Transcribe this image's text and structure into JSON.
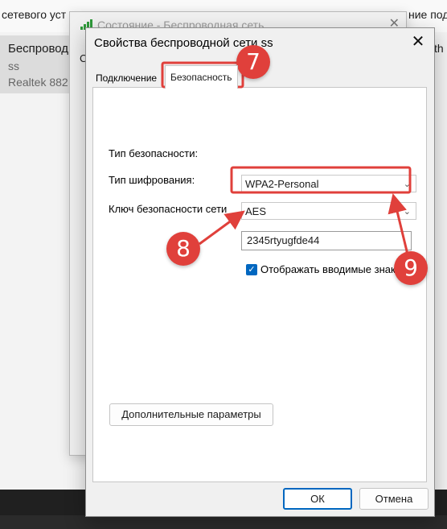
{
  "background": {
    "header_left": "сетевого уст",
    "header_right": "ние под",
    "right_fragment": "th",
    "side_items": [
      "Беспровод",
      "ss",
      "Realtek 882"
    ]
  },
  "status_window": {
    "title": "Состояние - Беспроводная сеть",
    "side_letter": "С"
  },
  "dialog": {
    "title": "Свойства беспроводной сети ss",
    "close_glyph": "✕",
    "tabs": [
      {
        "label": "Подключение",
        "active": false
      },
      {
        "label": "Безопасность",
        "active": true
      }
    ],
    "security_type_label": "Тип безопасности:",
    "security_type_value": "WPA2-Personal",
    "encryption_type_label": "Тип шифрования:",
    "encryption_type_value": "AES",
    "key_label": "Ключ безопасности сети",
    "key_value": "2345rtyugfde44",
    "show_chars_label": "Отображать вводимые знаки",
    "show_chars_checked": true,
    "advanced_button": "Дополнительные параметры",
    "ok_button": "ОК",
    "cancel_button": "Отмена"
  },
  "annotations": {
    "markers": [
      "7",
      "8",
      "9"
    ],
    "color": "#e0403b"
  }
}
